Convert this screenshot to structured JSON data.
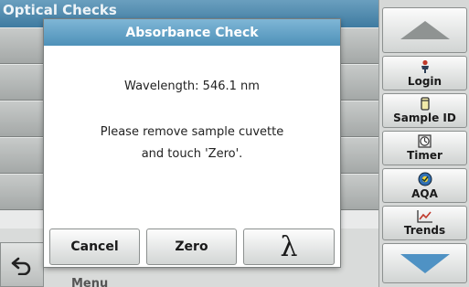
{
  "background": {
    "title": "Optical Checks",
    "menu_label": "Menu",
    "back_icon": "undo-arrow-icon"
  },
  "dialog": {
    "title": "Absorbance Check",
    "wavelength": "Wavelength: 546.1 nm",
    "message_line1": "Please remove sample cuvette",
    "message_line2": "and touch 'Zero'.",
    "buttons": {
      "cancel": "Cancel",
      "zero": "Zero",
      "lambda": "λ"
    }
  },
  "sidebar": {
    "up_icon": "scroll-up-icon",
    "down_icon": "scroll-down-icon",
    "items": [
      {
        "label": "Login",
        "icon": "user-icon"
      },
      {
        "label": "Sample ID",
        "icon": "sample-vial-icon"
      },
      {
        "label": "Timer",
        "icon": "timer-icon"
      },
      {
        "label": "AQA",
        "icon": "aqa-icon"
      },
      {
        "label": "Trends",
        "icon": "trend-chart-icon"
      }
    ]
  },
  "colors": {
    "header_blue": "#4e91b9",
    "arrow_blue": "#4f92c4",
    "panel_gray": "#d6d8d7"
  }
}
